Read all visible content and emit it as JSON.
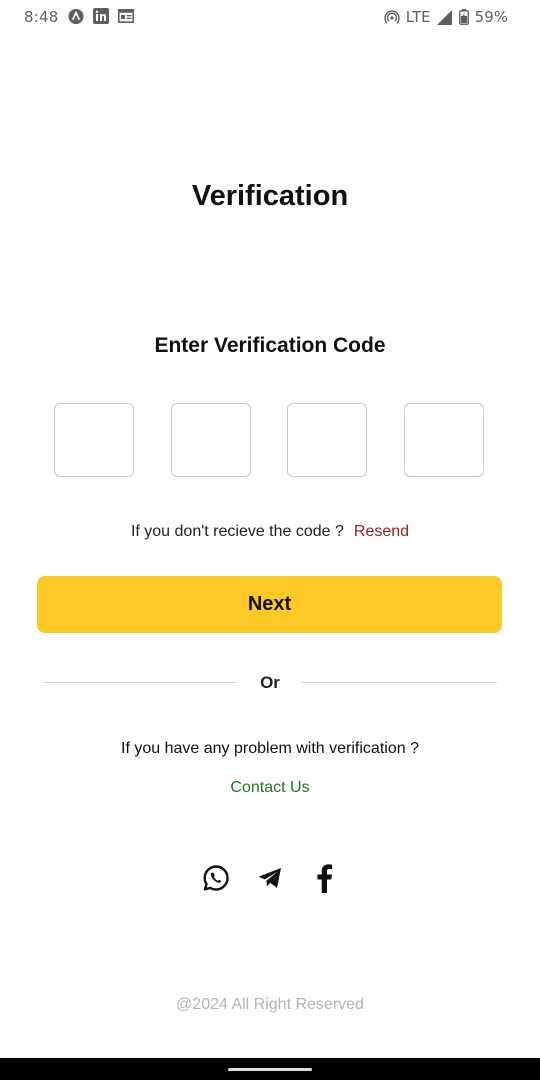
{
  "status_bar": {
    "time": "8:48",
    "network": "LTE",
    "battery": "59%",
    "icons": [
      "app-a-icon",
      "linkedin-icon",
      "news-icon",
      "hotspot-icon",
      "signal-icon",
      "battery-icon"
    ]
  },
  "page": {
    "title": "Verification",
    "subtitle": "Enter Verification Code"
  },
  "code_inputs": [
    "",
    "",
    "",
    ""
  ],
  "resend": {
    "prompt": "If you don't recieve the code ?",
    "link": "Resend"
  },
  "next_button": "Next",
  "divider_text": "Or",
  "help": {
    "prompt": "If you have any problem with verification ?",
    "contact_link": "Contact Us"
  },
  "social_icons": [
    "whatsapp-icon",
    "telegram-icon",
    "facebook-icon"
  ],
  "footer": "@2024 All Right Reserved",
  "colors": {
    "accent": "#fdc927",
    "resend": "#a01c1c",
    "contact": "#1f7a1f",
    "footer": "#b3b3b3"
  }
}
